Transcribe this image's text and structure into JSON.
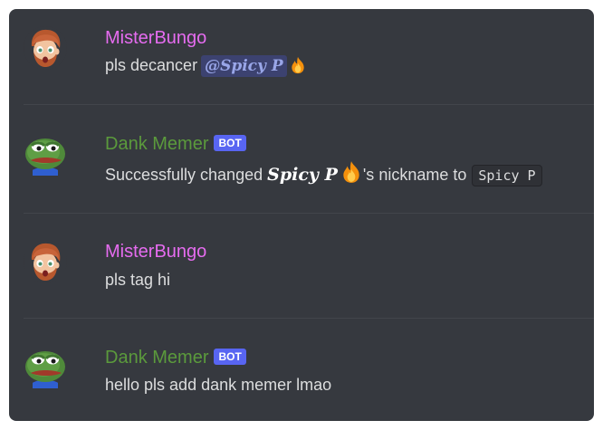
{
  "messages": [
    {
      "author": "MisterBungo",
      "avatar_icon": "cartoon-face-avatar-icon",
      "text": "pls decancer",
      "mention": "@Spicy P",
      "emoji": "fire-icon"
    },
    {
      "author": "Dank Memer",
      "badge": "BOT",
      "avatar_icon": "pepe-frog-avatar-icon",
      "text_before": "Successfully changed",
      "fancy_name": "Spicy P",
      "emoji": "fire-icon",
      "text_after": "'s nickname to",
      "code": "Spicy P"
    },
    {
      "author": "MisterBungo",
      "avatar_icon": "cartoon-face-avatar-icon",
      "text": "pls tag hi"
    },
    {
      "author": "Dank Memer",
      "badge": "BOT",
      "avatar_icon": "pepe-frog-avatar-icon",
      "text": "hello pls add dank memer lmao"
    }
  ],
  "colors": {
    "background": "#36393f",
    "human_name": "#e66cf0",
    "bot_name": "#5b9a3c",
    "bot_badge": "#5865f2",
    "mention_bg": "#3c4270",
    "mention_text": "#99a6e8"
  }
}
